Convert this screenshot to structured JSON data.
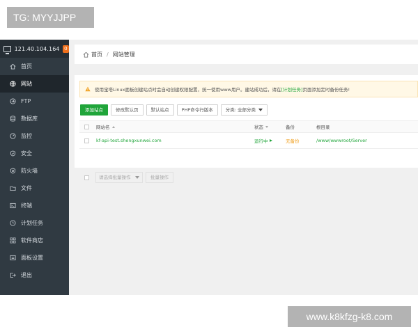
{
  "watermark_top": "TG: MYYJJPP",
  "watermark_bottom": "www.k8kfzg-k8.com",
  "server": {
    "ip": "121.40.104.164",
    "badge": "0"
  },
  "sidebar": {
    "items": [
      {
        "label": "首页",
        "icon": "home-icon"
      },
      {
        "label": "网站",
        "icon": "globe-icon",
        "active": true
      },
      {
        "label": "FTP",
        "icon": "ftp-icon"
      },
      {
        "label": "数据库",
        "icon": "database-icon"
      },
      {
        "label": "监控",
        "icon": "monitor-icon"
      },
      {
        "label": "安全",
        "icon": "shield-icon"
      },
      {
        "label": "防火墙",
        "icon": "firewall-icon"
      },
      {
        "label": "文件",
        "icon": "folder-icon"
      },
      {
        "label": "终端",
        "icon": "terminal-icon"
      },
      {
        "label": "计划任务",
        "icon": "clock-icon"
      },
      {
        "label": "软件商店",
        "icon": "apps-icon"
      },
      {
        "label": "面板设置",
        "icon": "settings-icon"
      },
      {
        "label": "退出",
        "icon": "logout-icon"
      }
    ]
  },
  "breadcrumb": {
    "home": "首页",
    "separator": "/",
    "current": "网站管理"
  },
  "notice": {
    "text_before": "使用宝塔Linux面板创建站点时会自动创建权限配置，统一使用www用户。建站成功后，请在",
    "link": "[计划任务]",
    "text_after": "页面添加定时备份任务!"
  },
  "toolbar": {
    "add_site": "添加站点",
    "default_page": "修改默认页",
    "default_site": "默认站点",
    "php_cli": "PHP命令行版本",
    "category": "分类: 全部分类"
  },
  "table": {
    "headers": {
      "name": "网站名",
      "status": "状态",
      "backup": "备份",
      "root": "根目录"
    },
    "rows": [
      {
        "name": "kf-api-test.shengxunwei.com",
        "status": "运行中",
        "backup": "无备份",
        "root": "/www/wwwroot/Server"
      }
    ]
  },
  "batch": {
    "placeholder": "请选择批量操作",
    "button": "批量操作"
  },
  "colors": {
    "accent": "#20a53a",
    "sidebar": "#303a42",
    "warning": "#f0a020"
  }
}
